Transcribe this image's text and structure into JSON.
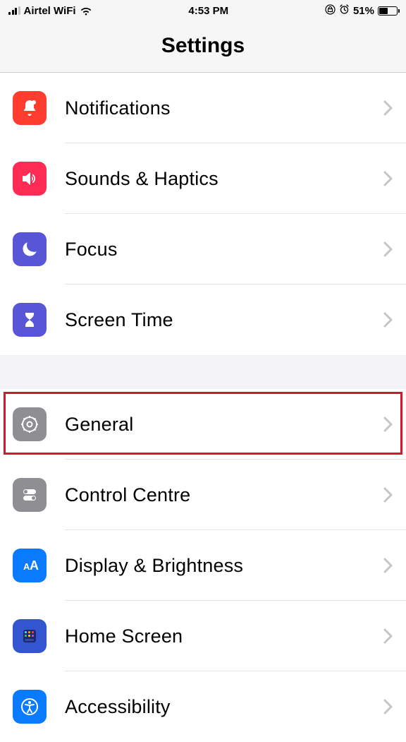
{
  "statusBar": {
    "carrier": "Airtel WiFi",
    "time": "4:53 PM",
    "battery": "51%"
  },
  "header": {
    "title": "Settings"
  },
  "section1": {
    "items": [
      {
        "label": "Notifications",
        "icon": "bell",
        "color": "#fe3c30"
      },
      {
        "label": "Sounds & Haptics",
        "icon": "speaker",
        "color": "#fe2c55"
      },
      {
        "label": "Focus",
        "icon": "moon",
        "color": "#5856d6"
      },
      {
        "label": "Screen Time",
        "icon": "hourglass",
        "color": "#5856d6"
      }
    ]
  },
  "section2": {
    "items": [
      {
        "label": "General",
        "icon": "gear",
        "color": "#8e8e93"
      },
      {
        "label": "Control Centre",
        "icon": "toggles",
        "color": "#8e8e93"
      },
      {
        "label": "Display & Brightness",
        "icon": "textsize",
        "color": "#0a7aff"
      },
      {
        "label": "Home Screen",
        "icon": "homescreen",
        "color": "#3355cf"
      },
      {
        "label": "Accessibility",
        "icon": "accessibility",
        "color": "#0a7aff"
      }
    ]
  }
}
